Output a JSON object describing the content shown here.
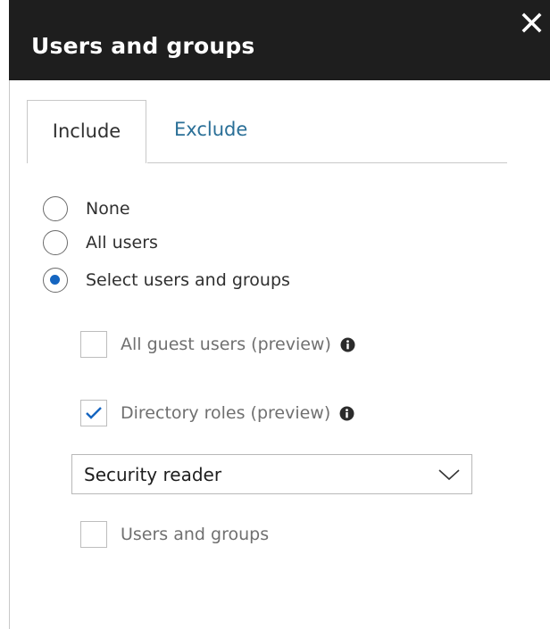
{
  "header": {
    "title": "Users and groups",
    "close_icon": "close-icon"
  },
  "tabs": [
    {
      "label": "Include",
      "selected": true
    },
    {
      "label": "Exclude",
      "selected": false
    }
  ],
  "radios": [
    {
      "label": "None",
      "checked": false
    },
    {
      "label": "All users",
      "checked": false
    },
    {
      "label": "Select users and groups",
      "checked": true
    }
  ],
  "options": {
    "guest_users": {
      "label": "All guest users (preview)",
      "checked": false,
      "icon": "info-icon"
    },
    "directory_roles": {
      "label": "Directory roles (preview)",
      "checked": true,
      "icon": "info-icon"
    },
    "roles_dropdown": {
      "value": "Security reader",
      "icon": "chevron-down-icon"
    },
    "users_and_groups": {
      "label": "Users and groups",
      "checked": false
    }
  },
  "colors": {
    "header_bg": "#1e1e1e",
    "accent": "#1565c0",
    "link": "#2a6f97"
  }
}
